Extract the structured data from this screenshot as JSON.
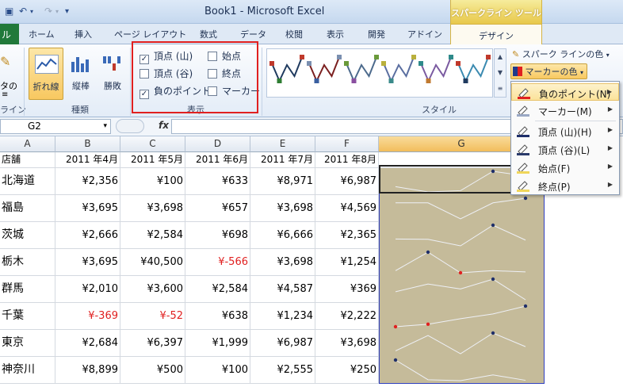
{
  "title_bar": {
    "window_title": "Book1 - Microsoft Excel",
    "context_title": "スパークライン ツール"
  },
  "tabs": {
    "file": "ル",
    "items": [
      "ホーム",
      "挿入",
      "ページ レイアウト",
      "数式",
      "データ",
      "校閲",
      "表示",
      "開発",
      "アドイン"
    ],
    "active": "デザイン"
  },
  "ribbon": {
    "edit_partial": "タの",
    "edit_partial2": "≡",
    "sparkline_group_partial": "ライン",
    "type_buttons": [
      {
        "label": "折れ線",
        "active": true
      },
      {
        "label": "縦棒",
        "active": false
      },
      {
        "label": "勝敗",
        "active": false
      }
    ],
    "type_group_label": "種類",
    "show_options": [
      {
        "label": "頂点 (山)",
        "checked": true
      },
      {
        "label": "始点",
        "checked": false
      },
      {
        "label": "頂点 (谷)",
        "checked": false
      },
      {
        "label": "終点",
        "checked": false
      },
      {
        "label": "負のポイント",
        "checked": true
      },
      {
        "label": "マーカー",
        "checked": false
      }
    ],
    "show_group_label": "表示",
    "style_group_label": "スタイル",
    "style_colors": [
      {
        "line": "#1f3a5f",
        "high": "#c0392b",
        "low": "#2e7d32"
      },
      {
        "line": "#7b1f1f",
        "high": "#7a8fb0",
        "low": "#3a5fa0"
      },
      {
        "line": "#4c6a8c",
        "high": "#6a9a3a",
        "low": "#8a4fa0"
      },
      {
        "line": "#5a6ea0",
        "high": "#b9b03c",
        "low": "#3a8a8a"
      },
      {
        "line": "#7a5aa0",
        "high": "#2e8a8a",
        "low": "#c07a30"
      },
      {
        "line": "#3a8ab0",
        "high": "#c0392b",
        "low": "#1f3a5f"
      }
    ],
    "sparkline_color_label": "スパーク ラインの色",
    "marker_color_label": "マーカーの色"
  },
  "marker_menu": {
    "items": [
      {
        "label": "負のポイント(N)",
        "color": "#e02020",
        "highlighted": true
      },
      {
        "label": "マーカー(M)",
        "color": "#9aa8c4",
        "highlighted": false
      },
      {
        "label": "頂点 (山)(H)",
        "color": "#1f2f6a",
        "highlighted": false
      },
      {
        "label": "頂点 (谷)(L)",
        "color": "#2a3a6a",
        "highlighted": false
      },
      {
        "label": "始点(F)",
        "color": "#f0d65a",
        "highlighted": false
      },
      {
        "label": "終点(P)",
        "color": "#f0d65a",
        "highlighted": false
      }
    ]
  },
  "formula_bar": {
    "name_box": "G2",
    "fx": "fx",
    "formula": ""
  },
  "sheet": {
    "columns": [
      "A",
      "B",
      "C",
      "D",
      "E",
      "F",
      "G"
    ],
    "selected_column": "G",
    "header_row": [
      "店舗",
      "2011 年4月",
      "2011 年5月",
      "2011 年6月",
      "2011 年7月",
      "2011 年8月"
    ],
    "rows": [
      {
        "store": "北海道",
        "values": [
          "¥2,356",
          "¥100",
          "¥633",
          "¥8,971",
          "¥6,987"
        ],
        "nums": [
          2356,
          100,
          633,
          8971,
          6987
        ]
      },
      {
        "store": "福島",
        "values": [
          "¥3,695",
          "¥3,698",
          "¥657",
          "¥3,698",
          "¥4,569"
        ],
        "nums": [
          3695,
          3698,
          657,
          3698,
          4569
        ]
      },
      {
        "store": "茨城",
        "values": [
          "¥2,666",
          "¥2,584",
          "¥698",
          "¥6,666",
          "¥2,365"
        ],
        "nums": [
          2666,
          2584,
          698,
          6666,
          2365
        ]
      },
      {
        "store": "栃木",
        "values": [
          "¥3,695",
          "¥40,500",
          "¥-566",
          "¥3,698",
          "¥1,254"
        ],
        "nums": [
          3695,
          40500,
          -566,
          3698,
          1254
        ]
      },
      {
        "store": "群馬",
        "values": [
          "¥2,010",
          "¥3,600",
          "¥2,584",
          "¥4,587",
          "¥369"
        ],
        "nums": [
          2010,
          3600,
          2584,
          4587,
          369
        ]
      },
      {
        "store": "千葉",
        "values": [
          "¥-369",
          "¥-52",
          "¥638",
          "¥1,234",
          "¥2,222"
        ],
        "nums": [
          -369,
          -52,
          638,
          1234,
          2222
        ]
      },
      {
        "store": "東京",
        "values": [
          "¥2,684",
          "¥6,397",
          "¥1,999",
          "¥6,987",
          "¥3,698"
        ],
        "nums": [
          2684,
          6397,
          1999,
          6987,
          3698
        ]
      },
      {
        "store": "神奈川",
        "values": [
          "¥8,899",
          "¥500",
          "¥100",
          "¥2,555",
          "¥250"
        ],
        "nums": [
          8899,
          500,
          100,
          2555,
          250
        ]
      }
    ]
  }
}
